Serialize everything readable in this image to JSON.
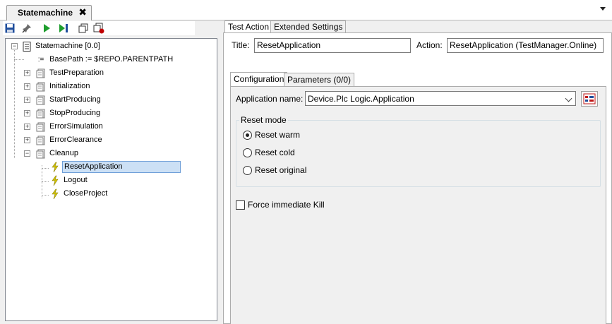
{
  "document_tab": {
    "title": "Statemachine",
    "close_glyph": "✖"
  },
  "toolbar": {
    "icons": [
      "save-icon",
      "pin-icon",
      "run-icon",
      "step-icon",
      "copy-icon",
      "breakpoint-icon"
    ]
  },
  "tree": {
    "root": "Statemachine [0.0]",
    "basepath": "BasePath := $REPO.PARENTPATH",
    "states": [
      "TestPreparation",
      "Initialization",
      "StartProducing",
      "StopProducing",
      "ErrorSimulation",
      "ErrorClearance",
      "Cleanup"
    ],
    "cleanup_actions": [
      "ResetApplication",
      "Logout",
      "CloseProject"
    ],
    "selected": "ResetApplication"
  },
  "right_tabs": [
    "Test Action",
    "Extended Settings"
  ],
  "fields": {
    "title_label": "Title:",
    "title_value": "ResetApplication",
    "action_label": "Action:",
    "action_value": "ResetApplication (TestManager.Online)"
  },
  "sub_tabs": [
    "Configuration",
    "Parameters (0/0)"
  ],
  "configuration": {
    "app_name_label": "Application name:",
    "app_name_value": "Device.Plc Logic.Application",
    "reset_mode_label": "Reset mode",
    "reset_options": [
      "Reset warm",
      "Reset cold",
      "Reset original"
    ],
    "reset_selected_index": 0,
    "force_kill_label": "Force immediate Kill",
    "force_kill_checked": false
  },
  "colors": {
    "selection_bg": "#cce0f5",
    "selection_border": "#6f9fd8",
    "save_blue": "#1f4e9c",
    "run_green": "#1e9e2e",
    "action_yellow": "#d4c500"
  }
}
